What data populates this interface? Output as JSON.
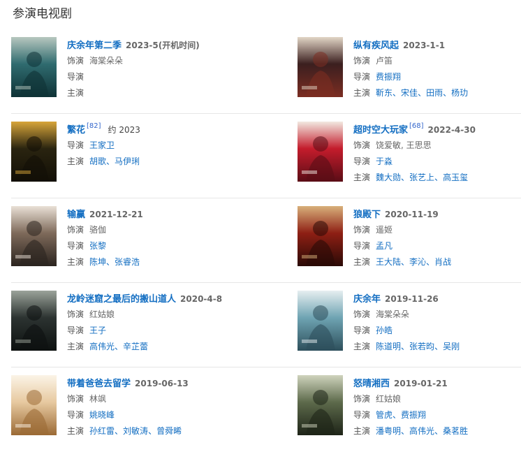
{
  "section": {
    "title": "参演电视剧"
  },
  "labels": {
    "role": "饰演",
    "director": "导演",
    "starring": "主演"
  },
  "dramas": [
    {
      "title": "庆余年第二季",
      "cite": "",
      "date": "2023-5(开机时间)",
      "date_plain": false,
      "role": "海棠朵朵",
      "director": [],
      "starring": [],
      "poster_colors": [
        "#2f6b6f",
        "#b7c7bf",
        "#0f3236"
      ]
    },
    {
      "title": "纵有疾风起",
      "cite": "",
      "date": "2023-1-1",
      "date_plain": false,
      "role": "卢笛",
      "director": [
        "费振翔"
      ],
      "starring": [
        "靳东",
        "宋佳",
        "田雨",
        "杨玏"
      ],
      "poster_colors": [
        "#3b1f1f",
        "#e2d6c6",
        "#7b2d22"
      ]
    },
    {
      "title": "繁花",
      "cite": "[82]",
      "date": "约 2023",
      "date_plain": true,
      "role": null,
      "director": [
        "王家卫"
      ],
      "starring": [
        "胡歌",
        "马伊琍"
      ],
      "poster_colors": [
        "#2a2410",
        "#d8a53a",
        "#120f06"
      ]
    },
    {
      "title": "超时空大玩家",
      "cite": "[68]",
      "date": "2022-4-30",
      "date_plain": false,
      "role": "饶爱敏, 王思思",
      "director": [
        "于淼"
      ],
      "starring": [
        "魏大勋",
        "张艺上",
        "高玉玺"
      ],
      "poster_colors": [
        "#c41c2c",
        "#f2e9e1",
        "#5a0d16"
      ]
    },
    {
      "title": "输赢",
      "cite": "",
      "date": "2021-12-21",
      "date_plain": false,
      "role": "骆伽",
      "director": [
        "张黎"
      ],
      "starring": [
        "陈坤",
        "张睿浩"
      ],
      "poster_colors": [
        "#7e6a5a",
        "#e9e0d6",
        "#2b241f"
      ]
    },
    {
      "title": "狼殿下",
      "cite": "",
      "date": "2020-11-19",
      "date_plain": false,
      "role": "遥姬",
      "director": [
        "孟凡"
      ],
      "starring": [
        "王大陆",
        "李沁",
        "肖战"
      ],
      "poster_colors": [
        "#8e1f14",
        "#d8b07a",
        "#2a0a06"
      ]
    },
    {
      "title": "龙岭迷窟之最后的搬山道人",
      "cite": "",
      "date": "2020-4-8",
      "date_plain": false,
      "role": "红姑娘",
      "director": [
        "王子"
      ],
      "starring": [
        "高伟光",
        "辛芷蕾"
      ],
      "poster_colors": [
        "#2c3331",
        "#9ba39a",
        "#0d1110"
      ]
    },
    {
      "title": "庆余年",
      "cite": "",
      "date": "2019-11-26",
      "date_plain": false,
      "role": "海棠朵朵",
      "director": [
        "孙皓"
      ],
      "starring": [
        "陈道明",
        "张若昀",
        "吴刚"
      ],
      "poster_colors": [
        "#6fa4b3",
        "#e6eef0",
        "#2d4f5b"
      ]
    },
    {
      "title": "带着爸爸去留学",
      "cite": "",
      "date": "2019-06-13",
      "date_plain": false,
      "role": "林飒",
      "director": [
        "姚晓峰"
      ],
      "starring": [
        "孙红雷",
        "刘敏涛",
        "曾舜晞"
      ],
      "poster_colors": [
        "#e7c9a0",
        "#fbf4e7",
        "#9b6a35"
      ]
    },
    {
      "title": "怒晴湘西",
      "cite": "",
      "date": "2019-01-21",
      "date_plain": false,
      "role": "红姑娘",
      "director": [
        "管虎",
        "费振翔"
      ],
      "starring": [
        "潘粤明",
        "高伟光",
        "桑茗胜"
      ],
      "poster_colors": [
        "#5d6a4b",
        "#cfd3bd",
        "#1e2418"
      ]
    }
  ]
}
